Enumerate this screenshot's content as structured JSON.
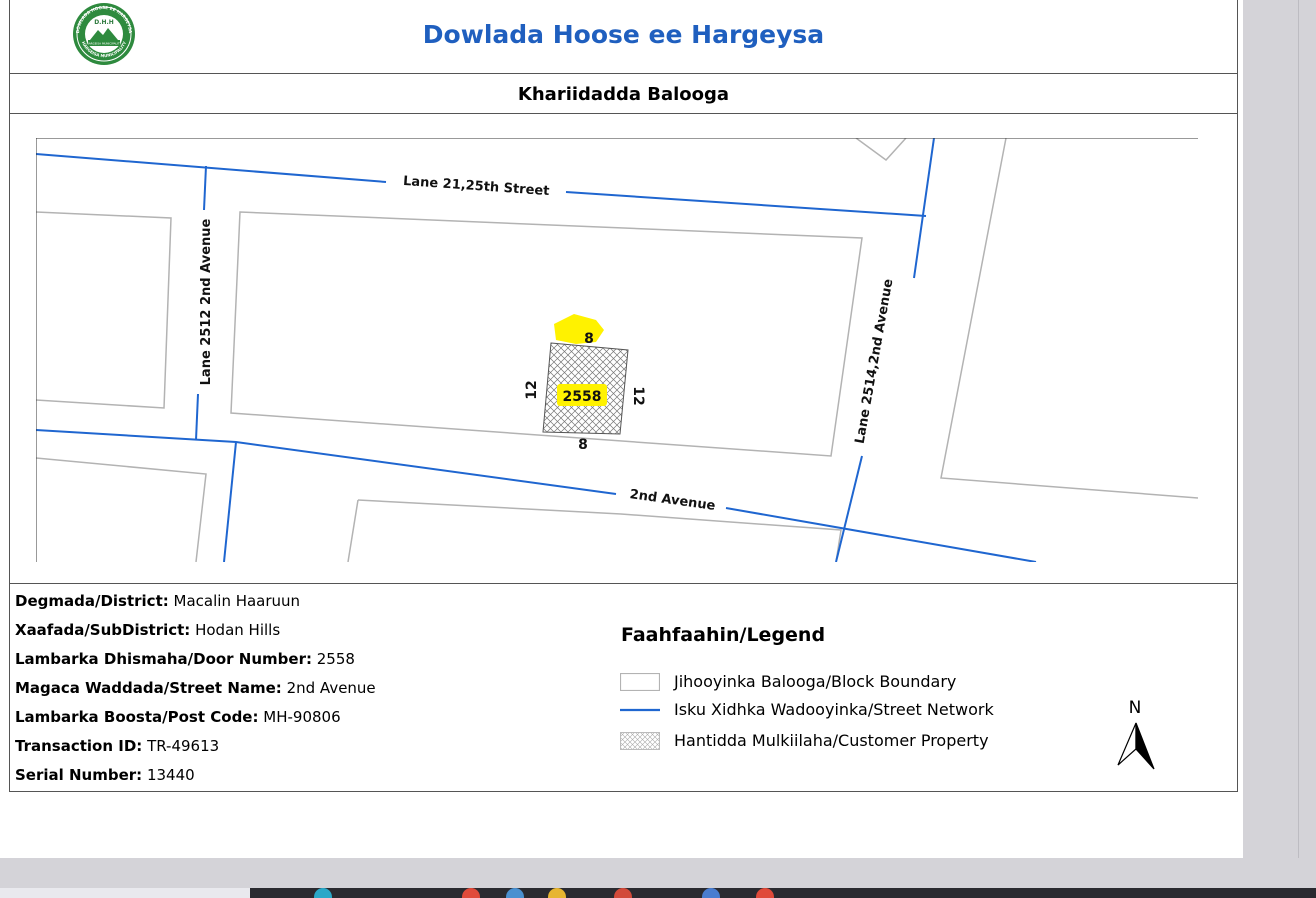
{
  "header": {
    "title": "Dowlada Hoose ee Hargeysa"
  },
  "logo": {
    "ring_text_top": "DOWLADA HOOSE EE HARGEYSA",
    "ring_text_bottom": "HARGEISA MUNICIPALITY",
    "center_text": "D.H.H",
    "banner_text": "HARGEISA MUNICIPALITY"
  },
  "subheader": {
    "title": "Khariidadda Balooga"
  },
  "map": {
    "streets": {
      "lane21": "Lane 21,25th Street",
      "lane2512": "Lane 2512 2nd Avenue",
      "lane2514": "Lane 2514,2nd Avenue",
      "second_avenue": "2nd Avenue"
    },
    "parcel": {
      "number": "2558",
      "top": "8",
      "bottom": "8",
      "left": "12",
      "right": "12"
    },
    "colors": {
      "street": "#1f66d0",
      "block": "#b3b3b3",
      "highlight": "#fff200"
    }
  },
  "info": [
    {
      "label": "Degmada/District:",
      "value": "Macalin Haaruun"
    },
    {
      "label": "Xaafada/SubDistrict:",
      "value": "Hodan Hills"
    },
    {
      "label": "Lambarka Dhismaha/Door Number:",
      "value": "2558"
    },
    {
      "label": "Magaca Waddada/Street Name:",
      "value": "2nd Avenue"
    },
    {
      "label": "Lambarka Boosta/Post Code:",
      "value": "MH-90806"
    },
    {
      "label": "Transaction ID:",
      "value": "TR-49613"
    },
    {
      "label": "Serial Number:",
      "value": "13440"
    }
  ],
  "legend": {
    "title": "Faahfaahin/Legend",
    "items": [
      {
        "label": "Jihooyinka Balooga/Block Boundary",
        "icon": "block-boundary"
      },
      {
        "label": "Isku Xidhka Wadooyinka/Street Network",
        "icon": "street-line"
      },
      {
        "label": "Hantidda Mulkiilaha/Customer Property",
        "icon": "hatched-parcel"
      }
    ]
  },
  "north_arrow": {
    "label": "N"
  }
}
